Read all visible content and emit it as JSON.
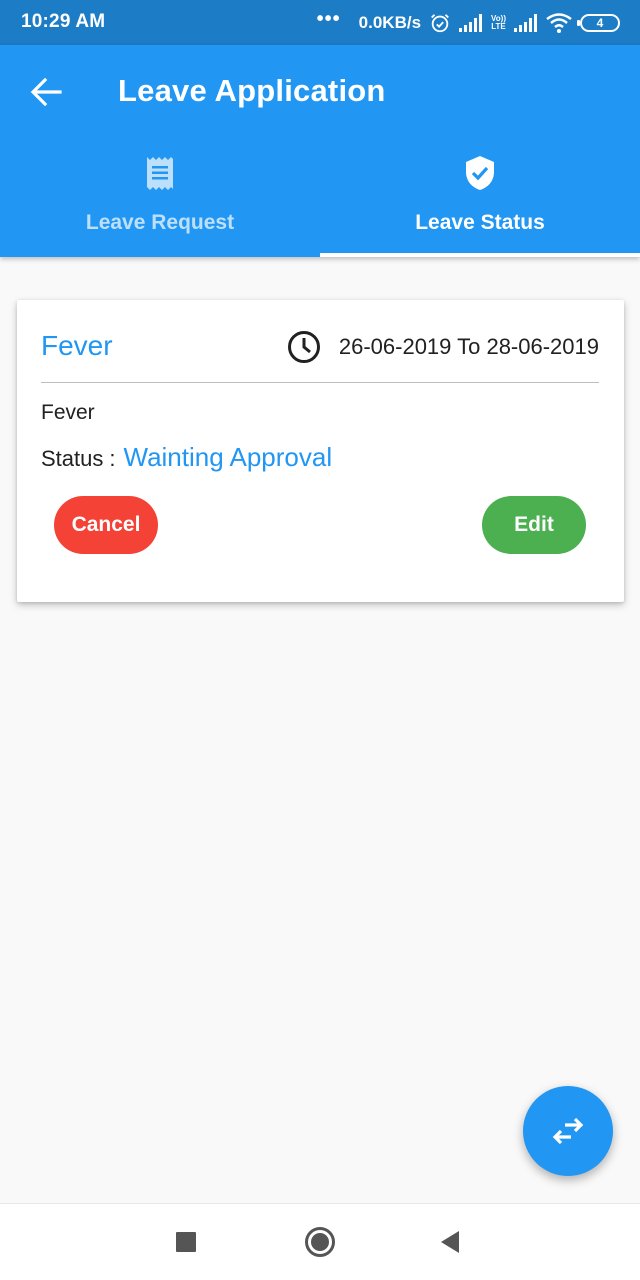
{
  "status_bar": {
    "time": "10:29 AM",
    "more": "•••",
    "speed": "0.0KB/s",
    "volte_line1": "Vo))",
    "volte_line2": "LTE",
    "battery": "4",
    "icons": [
      "alarm-icon",
      "signal-icon",
      "volte-icon",
      "signal-icon",
      "wifi-icon",
      "battery-icon"
    ]
  },
  "app_bar": {
    "back_icon": "arrow-left-icon",
    "title": "Leave Application",
    "tabs": [
      {
        "label": "Leave Request",
        "icon": "receipt-icon",
        "active": false
      },
      {
        "label": "Leave Status",
        "icon": "verified-shield-icon",
        "active": true
      }
    ]
  },
  "leave_card": {
    "title": "Fever",
    "clock_icon": "clock-icon",
    "date_range": "26-06-2019 To 28-06-2019",
    "reason": "Fever",
    "status_label": "Status",
    "status_separator": ":",
    "status_value": "Wainting Approval",
    "cancel_label": "Cancel",
    "edit_label": "Edit"
  },
  "fab": {
    "icon": "swap-horiz-icon"
  },
  "nav_bar": {
    "icons": [
      "square-recents-icon",
      "circle-home-icon",
      "triangle-back-icon"
    ]
  },
  "colors": {
    "status_bar": "#1c7cc6",
    "primary": "#2196f3",
    "cancel": "#f44336",
    "edit": "#4caf50",
    "background": "#f9f9f9"
  }
}
